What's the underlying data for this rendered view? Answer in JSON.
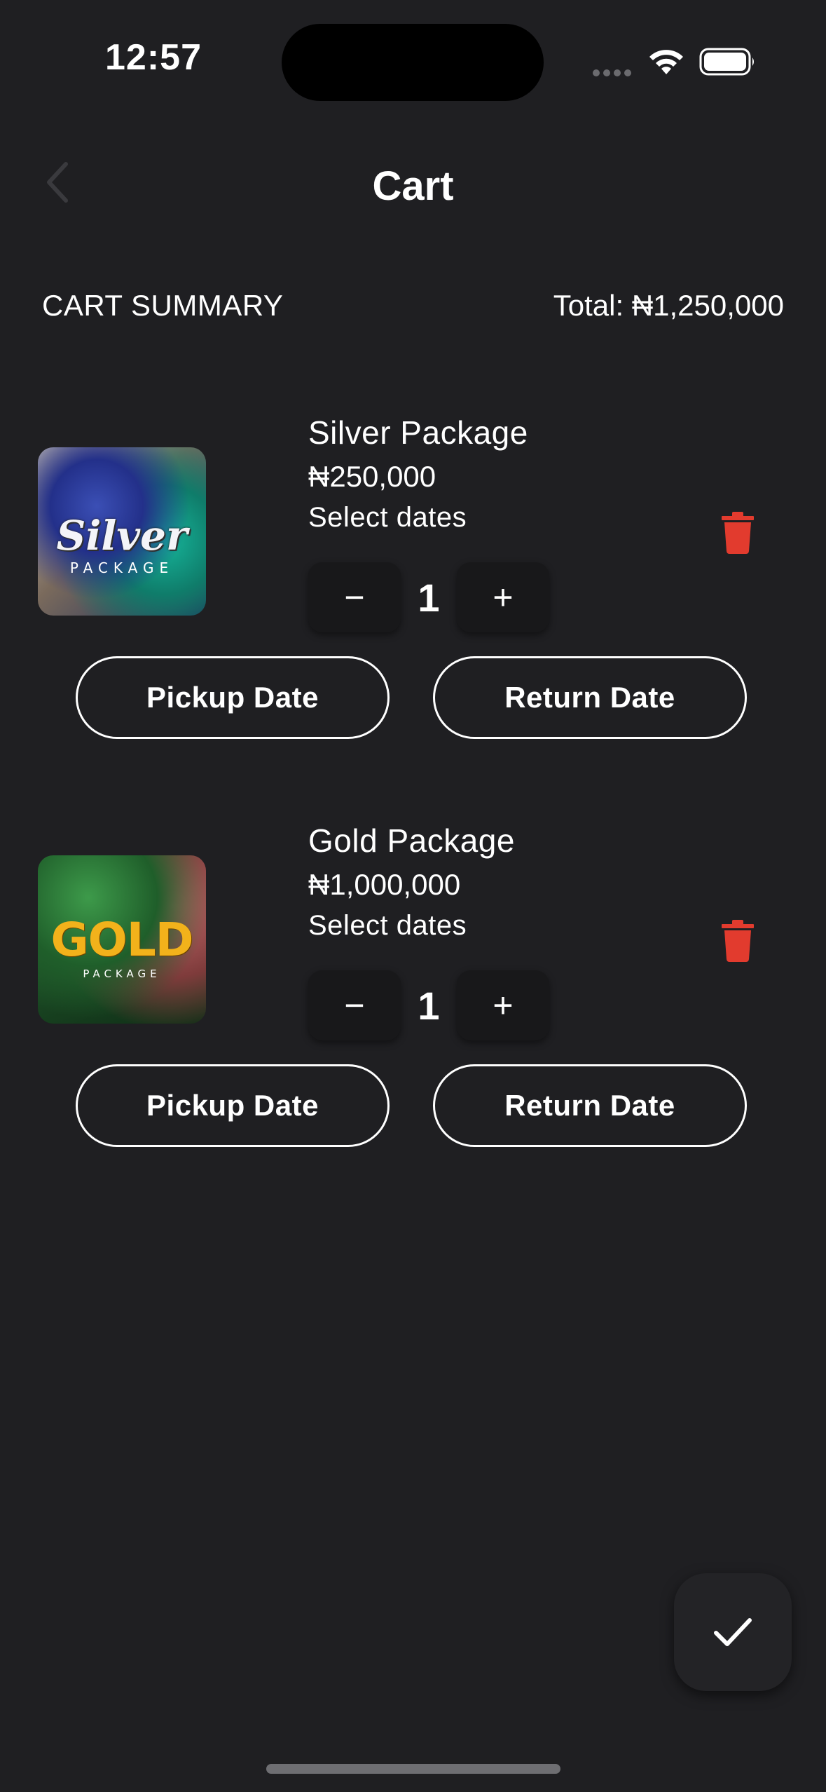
{
  "status_bar": {
    "time": "12:57"
  },
  "header": {
    "title": "Cart"
  },
  "summary": {
    "label": "CART SUMMARY",
    "total": "Total: ₦1,250,000"
  },
  "items": [
    {
      "name": "Silver Package",
      "price": "₦250,000",
      "dates_label": "Select dates",
      "quantity": "1",
      "decrement": "−",
      "increment": "+",
      "pickup_label": "Pickup Date",
      "return_label": "Return Date",
      "thumb_title": "Silver",
      "thumb_sub": "PACKAGE"
    },
    {
      "name": "Gold Package",
      "price": "₦1,000,000",
      "dates_label": "Select dates",
      "quantity": "1",
      "decrement": "−",
      "increment": "+",
      "pickup_label": "Pickup Date",
      "return_label": "Return Date",
      "thumb_title": "GOLD",
      "thumb_sub": "PACKAGE"
    }
  ],
  "colors": {
    "background": "#1f1f22",
    "delete": "#e23b2e",
    "text": "#ffffff"
  },
  "icons": {
    "back": "chevron-left-icon",
    "delete": "trash-icon",
    "confirm": "checkmark-icon"
  }
}
